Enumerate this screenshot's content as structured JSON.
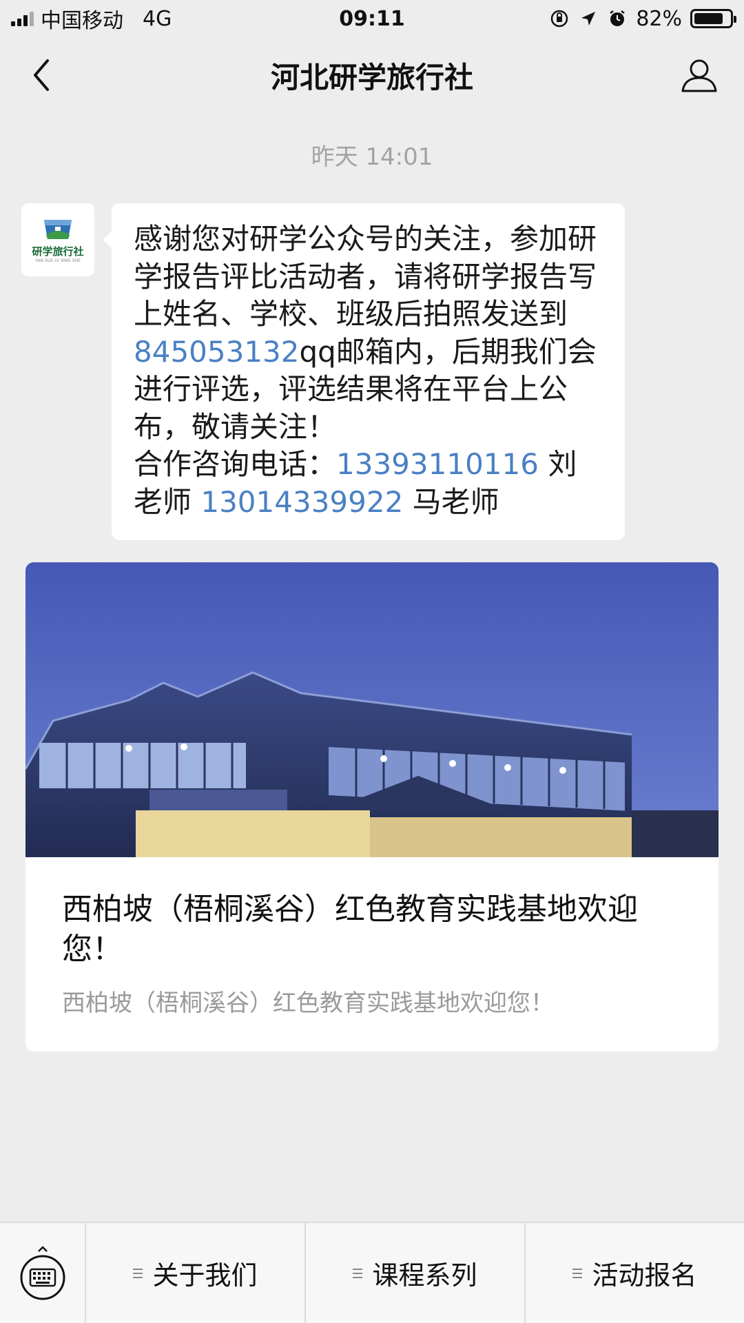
{
  "status_bar": {
    "carrier": "中国移动",
    "network": "4G",
    "time": "09:11",
    "battery_percent": "82%",
    "battery_level": 0.82
  },
  "nav": {
    "title": "河北研学旅行社",
    "back_icon": "chevron-left-icon",
    "profile_icon": "user-icon"
  },
  "chat": {
    "timestamp": "昨天 14:01",
    "avatar_text": "研学旅行社",
    "avatar_subtext": "YAN XUE LV XING SHE",
    "message": {
      "part1": "感谢您对研学公众号的关注，参加研学报告评比活动者，请将研学报告写上姓名、学校、班级后拍照发送到",
      "qq_number": "845053132",
      "part2": "qq邮箱内，后期我们会进行评选，评选结果将在平台上公布，敬请关注！",
      "consult_label": "合作咨询电话：",
      "phone1": "13393110116",
      "teacher1": " 刘老师 ",
      "phone2": "13014339922",
      "teacher2": " 马老师"
    }
  },
  "article": {
    "title": "西柏坡（梧桐溪谷）红色教育实践基地欢迎您！",
    "description": "西柏坡（梧桐溪谷）红色教育实践基地欢迎您！"
  },
  "bottom_menu": {
    "keyboard_icon": "keyboard-icon",
    "items": [
      {
        "label": "关于我们"
      },
      {
        "label": "课程系列"
      },
      {
        "label": "活动报名"
      }
    ]
  },
  "colors": {
    "background": "#ededed",
    "link": "#4a80c4",
    "bubble": "#ffffff",
    "timestamp": "#a3a3a3"
  }
}
